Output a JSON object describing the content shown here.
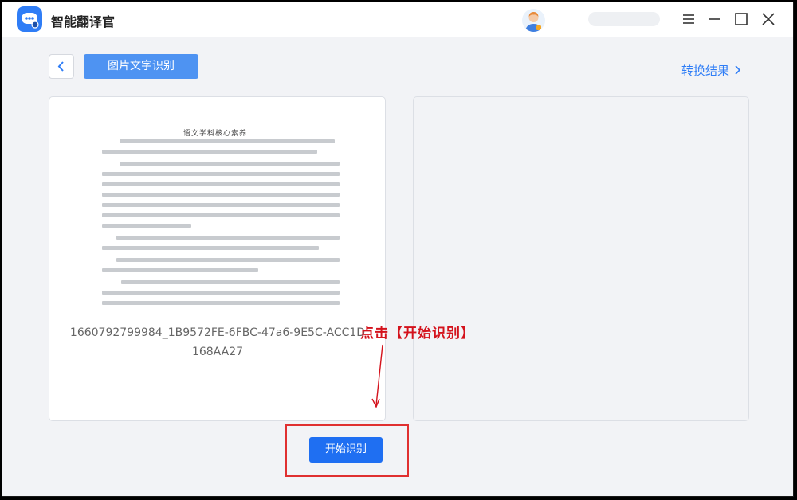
{
  "app": {
    "title": "智能翻译官"
  },
  "toolbar": {
    "mode_label": "图片文字识别",
    "result_link": "转换结果"
  },
  "document": {
    "title": "语文学科核心素养",
    "file_name": "1660792799984_1B9572FE-6FBC-47a6-9E5C-ACC1D168AA27"
  },
  "annotation": {
    "text": "点击【开始识别】"
  },
  "actions": {
    "start_label": "开始识别"
  },
  "colors": {
    "accent": "#1f6ff2",
    "annotation": "#d4121c",
    "tab": "#4e93f2"
  }
}
